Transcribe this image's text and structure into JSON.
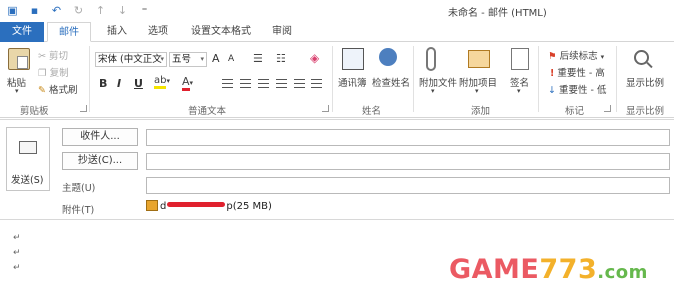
{
  "window": {
    "title": "未命名 - 邮件 (HTML)",
    "qat": [
      {
        "icon": "outlook-icon",
        "glyph": "▣"
      },
      {
        "icon": "save-icon",
        "glyph": "▪"
      },
      {
        "icon": "undo-icon",
        "glyph": "↶"
      },
      {
        "icon": "redo-icon",
        "glyph": "↻"
      },
      {
        "icon": "up-arrow-icon",
        "glyph": "↑"
      },
      {
        "icon": "down-arrow-icon",
        "glyph": "↓"
      },
      {
        "icon": "qat-dropdown-icon",
        "glyph": "⁼"
      }
    ]
  },
  "tabs": [
    "文件",
    "邮件",
    "插入",
    "选项",
    "设置文本格式",
    "审阅"
  ],
  "ribbon": {
    "clipboard": {
      "paste": "粘贴",
      "cut": "剪切",
      "copy": "复制",
      "format_painter": "格式刷",
      "group": "剪贴板"
    },
    "basic_text": {
      "font": "宋体 (中文正文",
      "size": "五号",
      "bold": "B",
      "italic": "I",
      "underline": "U",
      "grow": "A",
      "shrink": "A",
      "highlight": "ab",
      "color": "A",
      "group": "普通文本"
    },
    "names": {
      "address_book": "通讯簿",
      "check_names": "检查姓名",
      "group": "姓名"
    },
    "include": {
      "attach_file": "附加文件",
      "attach_item": "附加项目",
      "signature": "签名",
      "group": "添加"
    },
    "tags": {
      "follow_up": "后续标志",
      "high": "重要性 - 高",
      "low": "重要性 - 低",
      "group": "标记"
    },
    "zoom": {
      "zoom": "显示比例",
      "group": "显示比例"
    }
  },
  "compose": {
    "send": "发送(S)",
    "to_button": "收件人...",
    "cc_button": "抄送(C)...",
    "subject_label": "主题(U)",
    "attachment_label": "附件(T)",
    "attachment_name_start": "d",
    "attachment_name_end": "p",
    "attachment_size": "(25 MB)"
  },
  "body": {
    "pilcrows": [
      "↵",
      "↵",
      "↵"
    ]
  },
  "watermark": {
    "part1": "GAME",
    "part2": "773",
    "part3": ".com"
  },
  "colors": {
    "accent": "#2b6fbe",
    "redaction": "#e0212e",
    "watermark_red": "#eb5a63",
    "watermark_yellow": "#f3b12b",
    "watermark_green": "#66b84d"
  }
}
